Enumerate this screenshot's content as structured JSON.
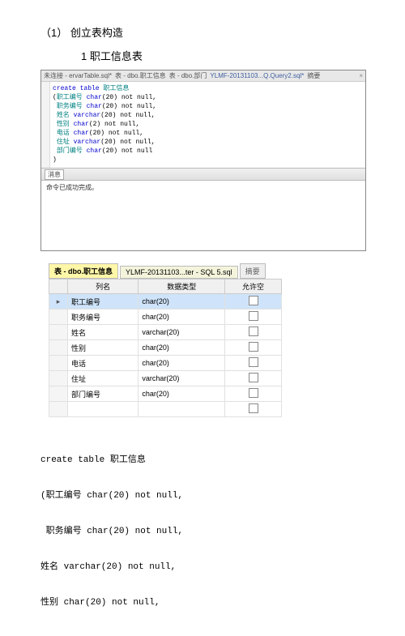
{
  "headings": {
    "h1": "（1）   创立表构造",
    "h2": "1 职工信息表"
  },
  "tabs": {
    "t1": "未连接 - ervarTable.sql*",
    "t2": "表 - dbo.职工信息",
    "t3": "表 - dbo.部门",
    "t4": "YLMF-20131103...Q.Query2.sql*",
    "t5": "摘要"
  },
  "sqlcode": {
    "l1a": "create table ",
    "l1b": "职工信息",
    "l2a": "(",
    "l2b": "职工编号 ",
    "l2c": "char",
    "l2d": "(20) not null,",
    "l3a": " ",
    "l3b": "职务编号 ",
    "l3c": "char",
    "l3d": "(20) not null,",
    "l4a": " ",
    "l4b": "姓名 ",
    "l4c": "varchar",
    "l4d": "(20) not null,",
    "l5a": " ",
    "l5b": "性别 ",
    "l5c": "char",
    "l5d": "(2) not null,",
    "l6a": " ",
    "l6b": "电话 ",
    "l6c": "char",
    "l6d": "(20) not null,",
    "l7a": " ",
    "l7b": "住址 ",
    "l7c": "varchar",
    "l7d": "(20) not null,",
    "l8a": " ",
    "l8b": "部门编号 ",
    "l8c": "char",
    "l8d": "(20) not null",
    "l9": ")"
  },
  "split_label": "消息",
  "result_msg": "命令已成功完成。",
  "designer_tabs": {
    "active": "表 - dbo.职工信息",
    "inactive": "YLMF-20131103...ter - SQL 5.sql",
    "summary": "摘要"
  },
  "designer_headers": {
    "c1": "列名",
    "c2": "数据类型",
    "c3": "允许空"
  },
  "designer_rows": [
    {
      "key": "▸",
      "name": "职工编号",
      "type": "char(20)",
      "selected": true
    },
    {
      "key": "",
      "name": "职务编号",
      "type": "char(20)",
      "selected": false
    },
    {
      "key": "",
      "name": "姓名",
      "type": "varchar(20)",
      "selected": false
    },
    {
      "key": "",
      "name": "性别",
      "type": "char(20)",
      "selected": false
    },
    {
      "key": "",
      "name": "电话",
      "type": "char(20)",
      "selected": false
    },
    {
      "key": "",
      "name": "住址",
      "type": "varchar(20)",
      "selected": false
    },
    {
      "key": "",
      "name": "部门编号",
      "type": "char(20)",
      "selected": false
    }
  ],
  "snippet": {
    "l1": "create table 职工信息",
    "l2": "(职工编号 char(20) not null,",
    "l3": " 职务编号 char(20) not null,",
    "l4": "姓名 varchar(20) not null,",
    "l5": "性别 char(20) not null,"
  }
}
